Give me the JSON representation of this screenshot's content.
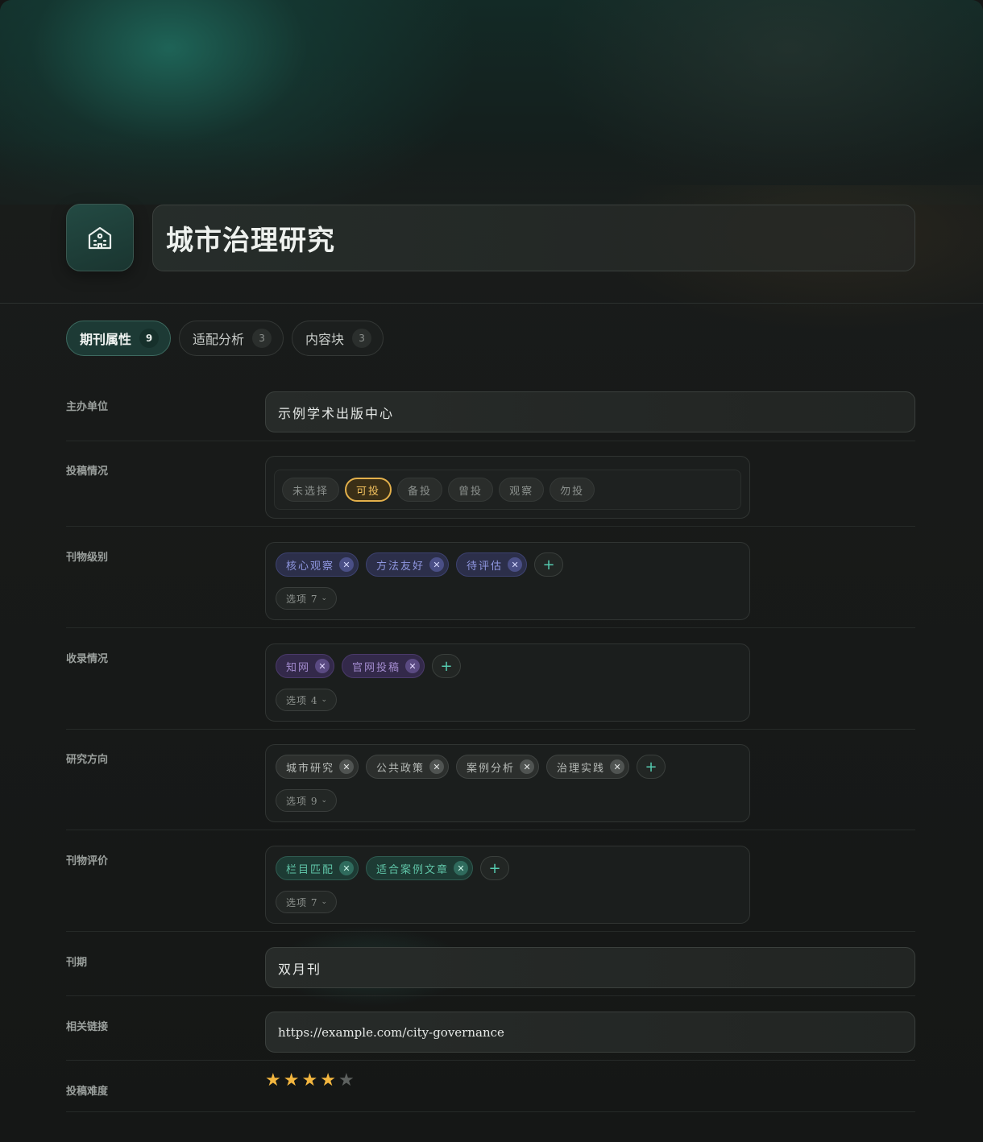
{
  "journal": {
    "title": "城市治理研究",
    "icon": "building-icon"
  },
  "tabs": [
    {
      "label": "期刊属性",
      "count": "9",
      "active": true
    },
    {
      "label": "适配分析",
      "count": "3",
      "active": false
    },
    {
      "label": "内容块",
      "count": "3",
      "active": false
    }
  ],
  "fields": {
    "sponsor": {
      "label": "主办单位",
      "value": "示例学术出版中心"
    },
    "submission": {
      "label": "投稿情况",
      "options": [
        "未选择",
        "可投",
        "备投",
        "曾投",
        "观察",
        "勿投"
      ],
      "selected": "可投"
    },
    "level": {
      "label": "刊物级别",
      "tags": [
        "核心观察",
        "方法友好",
        "待评估"
      ],
      "options_label": "选项 7"
    },
    "indexing": {
      "label": "收录情况",
      "tags": [
        "知网",
        "官网投稿"
      ],
      "options_label": "选项 4"
    },
    "research": {
      "label": "研究方向",
      "tags": [
        "城市研究",
        "公共政策",
        "案例分析",
        "治理实践"
      ],
      "options_label": "选项 9"
    },
    "evaluation": {
      "label": "刊物评价",
      "tags": [
        "栏目匹配",
        "适合案例文章"
      ],
      "options_label": "选项 7"
    },
    "period": {
      "label": "刊期",
      "value": "双月刊"
    },
    "link": {
      "label": "相关链接",
      "value": "https://example.com/city-governance"
    },
    "difficulty": {
      "label": "投稿难度",
      "rating": 4,
      "max": 5
    }
  },
  "colors": {
    "accent": "#55cbb0",
    "selected_option": "#e3b04b",
    "star": "#f3b63f"
  }
}
